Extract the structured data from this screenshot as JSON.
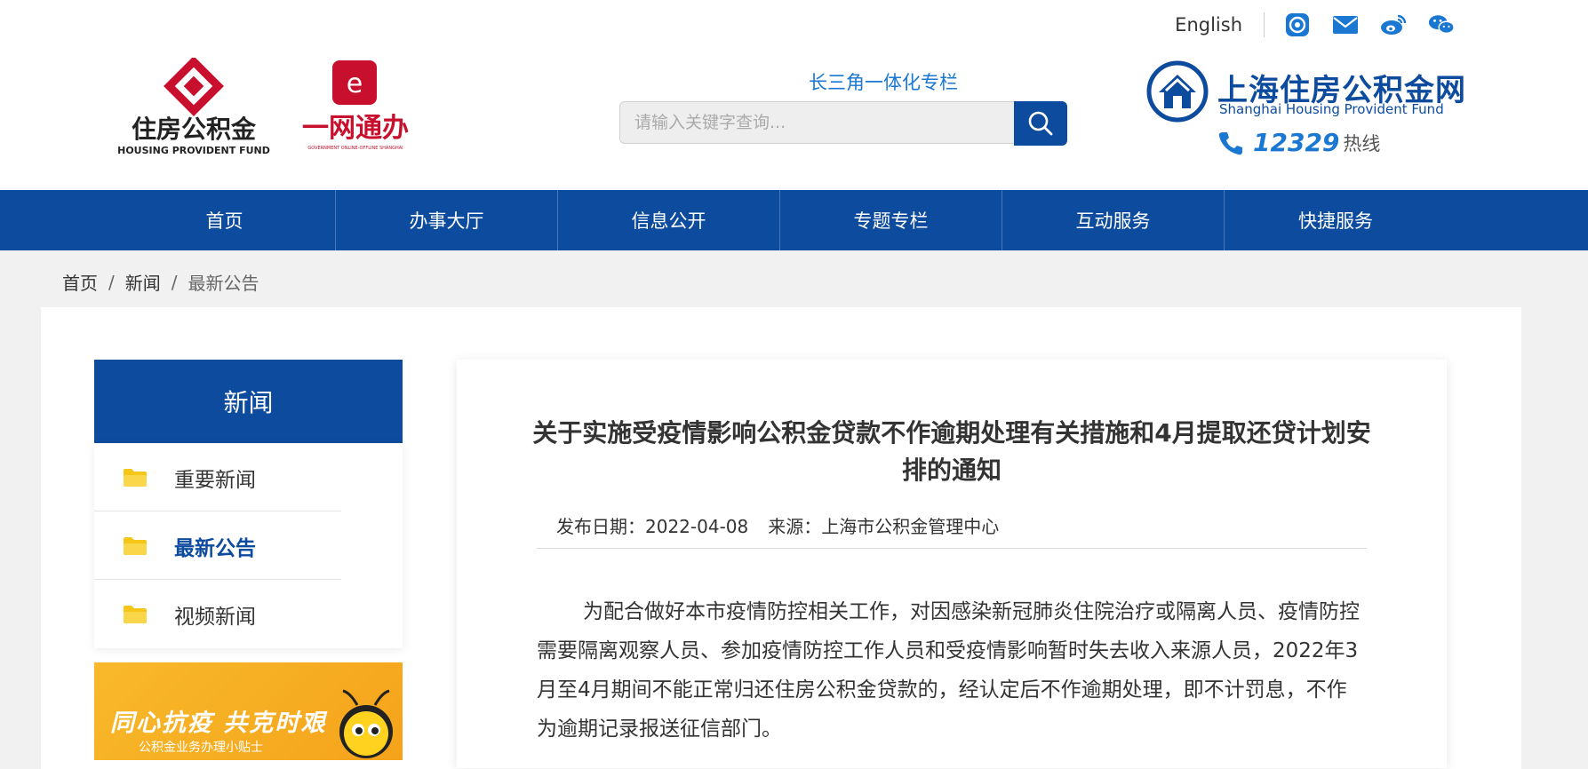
{
  "topbar": {
    "english": "English"
  },
  "logos": {
    "hpf_cn": "住房公积金",
    "hpf_en": "HOUSING PROVIDENT FUND",
    "ywtb_cn": "一网通办",
    "ywtb_en": "GOVERNMENT ONLINE-OFFLINE SHANGHAI"
  },
  "header": {
    "yrd_link": "长三角一体化专栏",
    "search_placeholder": "请输入关键字查询...",
    "brand_cn": "上海住房公积金网",
    "brand_en": "Shanghai Housing Provident Fund",
    "hotline_number": "12329",
    "hotline_label": "热线"
  },
  "nav": [
    "首页",
    "办事大厅",
    "信息公开",
    "专题专栏",
    "互动服务",
    "快捷服务"
  ],
  "breadcrumb": {
    "home": "首页",
    "news": "新闻",
    "current": "最新公告",
    "sep": "/"
  },
  "sidebar": {
    "title": "新闻",
    "items": [
      {
        "label": "重要新闻"
      },
      {
        "label": "最新公告"
      },
      {
        "label": "视频新闻"
      }
    ],
    "active_index": 1
  },
  "banner": {
    "text": "同心抗疫 共克时艰",
    "sub": "公积金业务办理小贴士"
  },
  "article": {
    "title": "关于实施受疫情影响公积金贷款不作逾期处理有关措施和4月提取还贷计划安排的通知",
    "date_label": "发布日期：",
    "date": "2022-04-08",
    "source_label": "来源：",
    "source": "上海市公积金管理中心",
    "paragraph": "为配合做好本市疫情防控相关工作，对因感染新冠肺炎住院治疗或隔离人员、疫情防控需要隔离观察人员、参加疫情防控工作人员和受疫情影响暂时失去收入来源人员，2022年3月至4月期间不能正常归还住房公积金贷款的，经认定后不作逾期处理，即不计罚息，不作为逾期记录报送征信部门。"
  },
  "colors": {
    "primary": "#0d4b9e",
    "link": "#1a77d2",
    "accent_red": "#c8102e",
    "folder": "#f5c518"
  },
  "icons": [
    "service-icon",
    "mail-icon",
    "weibo-icon",
    "wechat-icon",
    "search-icon",
    "phone-icon",
    "folder-icon"
  ]
}
